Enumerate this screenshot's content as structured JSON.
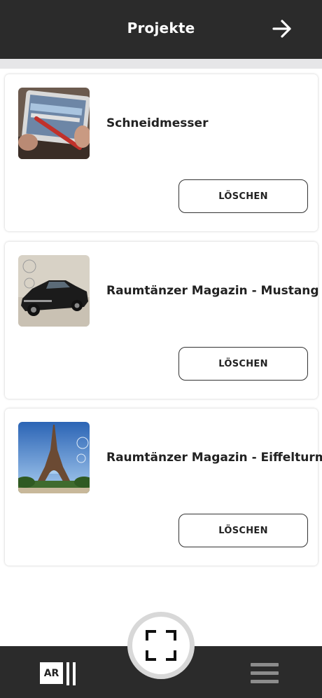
{
  "header": {
    "title": "Projekte",
    "forward_icon": "arrow-right-icon"
  },
  "projects": [
    {
      "title": "Schneidmesser",
      "delete_label": "LÖSCHEN",
      "thumbnail": "tablet-photo"
    },
    {
      "title": "Raumtänzer Magazin - Mustang",
      "delete_label": "LÖSCHEN",
      "thumbnail": "mustang-car-photo"
    },
    {
      "title": "Raumtänzer Magazin - Eiffelturm",
      "delete_label": "LÖSCHEN",
      "thumbnail": "eiffel-tower-photo"
    }
  ],
  "bottom_nav": {
    "ar_logo_text": "AR",
    "scan_icon": "scan-frame-icon",
    "menu_icon": "hamburger-menu-icon"
  },
  "colors": {
    "bar": "#2b2b2b",
    "text": "#222222",
    "subbar": "#e6e6e8"
  }
}
